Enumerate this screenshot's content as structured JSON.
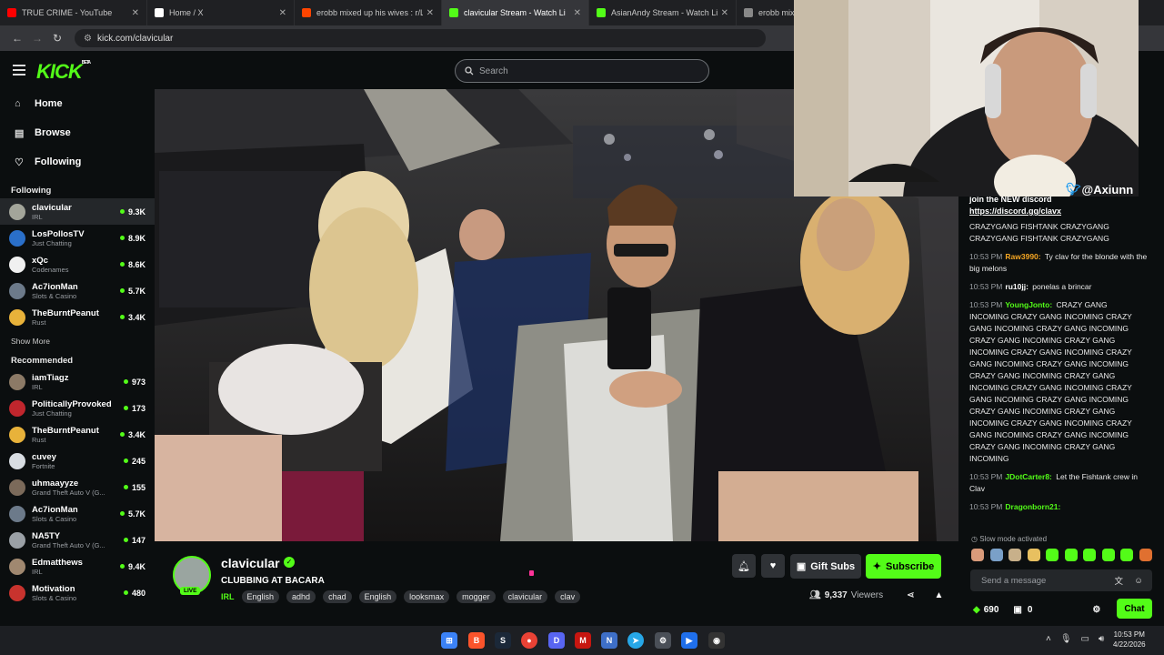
{
  "browser": {
    "tabs": [
      {
        "title": "TRUE CRIME - YouTube",
        "color": "#ff0000",
        "active": false
      },
      {
        "title": "Home / X",
        "color": "#ffffff",
        "active": false
      },
      {
        "title": "erobb mixed up his wives : r/Liv",
        "color": "#ff4500",
        "active": false
      },
      {
        "title": "clavicular Stream - Watch Li",
        "color": "#53fc18",
        "active": true
      },
      {
        "title": "AsianAndy Stream - Watch Live",
        "color": "#53fc18",
        "active": false
      },
      {
        "title": "erobb mixed u",
        "color": "#888888",
        "active": false
      }
    ],
    "url": "kick.com/clavicular"
  },
  "header": {
    "logo": "KICK",
    "logo_badge": "BETA",
    "search_placeholder": "Search"
  },
  "sidebar": {
    "nav": [
      {
        "label": "Home",
        "icon": "home-icon"
      },
      {
        "label": "Browse",
        "icon": "browse-icon"
      },
      {
        "label": "Following",
        "icon": "heart-icon"
      }
    ],
    "following_title": "Following",
    "following": [
      {
        "name": "clavicular",
        "category": "IRL",
        "viewers": "9.3K",
        "color": "#a3a59a"
      },
      {
        "name": "LosPollosTV",
        "category": "Just Chatting",
        "viewers": "8.9K",
        "color": "#2a6fc9"
      },
      {
        "name": "xQc",
        "category": "Codenames",
        "viewers": "8.6K",
        "color": "#f0f0f0"
      },
      {
        "name": "Ac7ionMan",
        "category": "Slots & Casino",
        "viewers": "5.7K",
        "color": "#6c7a8a"
      },
      {
        "name": "TheBurntPeanut",
        "category": "Rust",
        "viewers": "3.4K",
        "color": "#e8b23a"
      }
    ],
    "show_more": "Show More",
    "recommended_title": "Recommended",
    "recommended": [
      {
        "name": "iamTiagz",
        "category": "IRL",
        "viewers": "973",
        "color": "#8c7a66"
      },
      {
        "name": "PoliticallyProvoked",
        "category": "Just Chatting",
        "viewers": "173",
        "color": "#c0262d"
      },
      {
        "name": "TheBurntPeanut",
        "category": "Rust",
        "viewers": "3.4K",
        "color": "#e8b23a"
      },
      {
        "name": "cuvey",
        "category": "Fortnite",
        "viewers": "245",
        "color": "#d8dde2"
      },
      {
        "name": "uhmaayyze",
        "category": "Grand Theft Auto V (G...",
        "viewers": "155",
        "color": "#7b6a5a"
      },
      {
        "name": "Ac7ionMan",
        "category": "Slots & Casino",
        "viewers": "5.7K",
        "color": "#6c7a8a"
      },
      {
        "name": "NA5TY",
        "category": "Grand Theft Auto V (G...",
        "viewers": "147",
        "color": "#9aa0a6"
      },
      {
        "name": "Edmatthews",
        "category": "IRL",
        "viewers": "9.4K",
        "color": "#a08870"
      },
      {
        "name": "Motivation",
        "category": "Slots & Casino",
        "viewers": "480",
        "color": "#c8332e"
      }
    ]
  },
  "stream": {
    "channel": "clavicular",
    "live_badge": "LIVE",
    "title": "CLUBBING AT BACARA",
    "category": "IRL",
    "tags": [
      "English",
      "adhd",
      "chad",
      "English",
      "looksmax",
      "mogger",
      "clavicular",
      "clav"
    ],
    "viewers": "9,337",
    "viewers_label": "Viewers",
    "gift_label": "Gift Subs",
    "subscribe_label": "Subscribe"
  },
  "camera_overlay": {
    "handle": "@Axiunn"
  },
  "chat": {
    "pinned_line": "join the NEW discord",
    "pinned_link": "https://discord.gg/clavx",
    "pinned_continuation": "CRAZYGANG FISHTANK CRAZYGANG CRAZYGANG FISHTANK CRAZYGANG",
    "messages": [
      {
        "time": "10:53 PM",
        "user": "Raw3990:",
        "color": "#f5a623",
        "text": "Ty clav for the blonde with the big melons"
      },
      {
        "time": "10:53 PM",
        "user": "ru10jj:",
        "color": "#ffffff",
        "text": "ponelas a brincar"
      },
      {
        "time": "10:53 PM",
        "user": "YoungJonto:",
        "color": "#53fc18",
        "text": "CRAZY GANG INCOMING CRAZY GANG INCOMING CRAZY GANG INCOMING CRAZY GANG INCOMING CRAZY GANG INCOMING CRAZY GANG INCOMING CRAZY GANG INCOMING CRAZY GANG INCOMING CRAZY GANG INCOMING CRAZY GANG INCOMING CRAZY GANG INCOMING CRAZY GANG INCOMING CRAZY GANG INCOMING CRAZY GANG INCOMING CRAZY GANG INCOMING CRAZY GANG INCOMING CRAZY GANG INCOMING CRAZY GANG INCOMING CRAZY GANG INCOMING CRAZY GANG INCOMING CRAZY GANG INCOMING"
      },
      {
        "time": "10:53 PM",
        "user": "JDotCarter8:",
        "color": "#53fc18",
        "text": "Let the Fishtank crew in Clav"
      },
      {
        "time": "10:53 PM",
        "user": "Dragonborn21:",
        "color": "#53fc18",
        "text": ""
      }
    ],
    "slow_mode": "Slow mode activated",
    "input_placeholder": "Send a message",
    "points": "690",
    "gifts": "0",
    "chat_button": "Chat"
  },
  "taskbar": {
    "time": "10:53 PM",
    "date": "4/22/2026"
  }
}
